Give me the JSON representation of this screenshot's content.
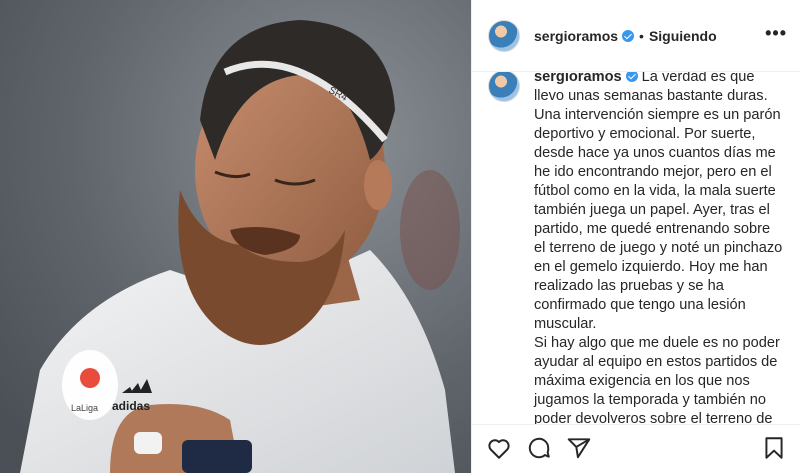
{
  "post": {
    "username": "sergioramos",
    "separator": "•",
    "follow_status": "Siguiendo",
    "more_icon": "•••",
    "caption": "La verdad es que llevo unas semanas bastante duras. Una intervención siempre es un parón deportivo y emocional. Por suerte, desde hace ya unos cuantos días me he ido encontrando mejor, pero en el fútbol como en la vida, la mala suerte también juega un papel. Ayer, tras el partido, me quedé entrenando sobre el terreno de juego y noté un pinchazo en el gemelo izquierdo. Hoy me han realizado las pruebas y se ha confirmado que tengo una lesión muscular.\nSi hay algo que me duele es no poder ayudar al equipo en estos partidos de máxima exigencia en los que nos jugamos la temporada y también no poder devolveros sobre el terreno de juego el cariño y la"
  },
  "photo": {
    "headband_text": "SR4",
    "kit_brand": "adidas",
    "liga_text": "LaLiga"
  },
  "colors": {
    "verified": "#3897f0",
    "text": "#262626",
    "border": "#efefef"
  },
  "actions": {
    "like_icon": "heart-icon",
    "comment_icon": "comment-icon",
    "share_icon": "share-icon",
    "save_icon": "bookmark-icon"
  }
}
